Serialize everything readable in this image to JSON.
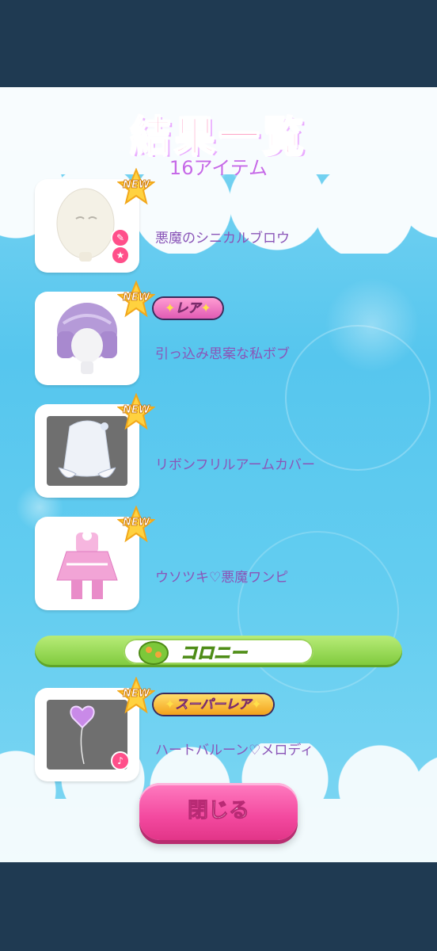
{
  "header": {
    "title": "結果一覧",
    "subtitle": "16アイテム"
  },
  "items": [
    {
      "badge": "NEW",
      "rarity": "",
      "name": "悪魔のシニカルブロウ",
      "category_icons": [
        "brush-icon",
        "star-icon"
      ]
    },
    {
      "badge": "NEW",
      "rarity": "レア",
      "name": "引っ込み思案な私ボブ",
      "category_icons": []
    },
    {
      "badge": "NEW",
      "rarity": "",
      "name": "リボンフリルアームカバー",
      "category_icons": []
    },
    {
      "badge": "NEW",
      "rarity": "",
      "name": "ウソツキ♡悪魔ワンピ",
      "category_icons": []
    },
    {
      "badge": "NEW",
      "rarity": "スーパーレア",
      "name": "ハートバルーン♡メロディ",
      "category_icons": [
        "music-note-icon"
      ]
    }
  ],
  "section": {
    "label": "コロニー"
  },
  "footer": {
    "close_label": "閉じる"
  },
  "colors": {
    "panel_top": "#7fd6f2",
    "panel_mid": "#56c6ee",
    "outer_background": "#1f3a52",
    "item_name_text": "#8a55b8",
    "close_button": "#f3499f",
    "section_bar": "#8ccf3f"
  }
}
